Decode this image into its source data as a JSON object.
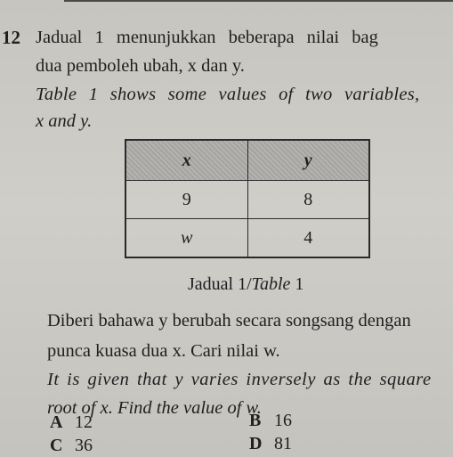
{
  "question": {
    "number": "12",
    "malay_line1": "Jadual 1 menunjukkan beberapa nilai bag",
    "malay_line2": "dua pemboleh ubah, x dan y.",
    "english_line1": "Table 1 shows some values of two variables,",
    "english_line2": "x and y."
  },
  "table": {
    "headers": [
      "x",
      "y"
    ],
    "rows": [
      [
        "9",
        "8"
      ],
      [
        "w",
        "4"
      ]
    ],
    "caption_malay": "Jadual 1/",
    "caption_english_word": "Table",
    "caption_english_num": " 1"
  },
  "prompt": {
    "malay_line1": "Diberi bahawa y berubah secara songsang dengan",
    "malay_line2": "punca kuasa dua x. Cari nilai w.",
    "english_line1": "It is given that y varies inversely as the square",
    "english_line2": "root of x. Find the value of w."
  },
  "options": [
    {
      "letter": "A",
      "value": "12"
    },
    {
      "letter": "B",
      "value": "16"
    },
    {
      "letter": "C",
      "value": "36"
    },
    {
      "letter": "D",
      "value": "81"
    }
  ]
}
